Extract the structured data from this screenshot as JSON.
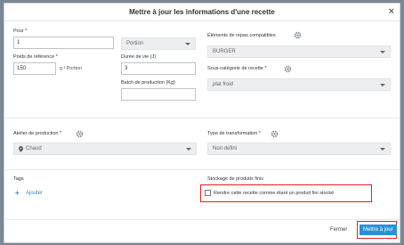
{
  "modal": {
    "title": "Mettre à jour les informations d'une recette",
    "close_symbol": "×"
  },
  "form": {
    "pour_label": "Pour *",
    "pour_value": "1",
    "portion_select": "Portion",
    "poids_label": "Poids de référence *",
    "poids_value": "150",
    "poids_unit": "g / Portion",
    "duree_label": "Durée de vie (J)",
    "duree_value": "3",
    "batch_label": "Batch de production (Kg)",
    "batch_value": "",
    "elements_label": "Éléments de repas compatibles",
    "elements_value": "BURGER",
    "souscat_label": "Sous-catégorie de recette *",
    "souscat_value": "plat froid",
    "atelier_label": "Atelier de production *",
    "atelier_value": "Chaud",
    "type_label": "Type de transformation *",
    "type_value": "Non défini",
    "tags_label": "Tags",
    "ajouter_label": "Ajouter",
    "stockage_label": "Stockage de produits finis",
    "stockage_checkbox_label": "Rendre cette recette comme étant un produit fini stocké",
    "stockage_checked": false
  },
  "footer": {
    "fermer_label": "Fermer",
    "mettre_a_jour_label": "Mettre à jour"
  },
  "colors": {
    "primary": "#2c8fd6",
    "highlight": "#e0202a",
    "backdrop": "#7c8794"
  },
  "icons": [
    "close-icon",
    "gear-icon",
    "chevron-down-icon",
    "location-pin-icon",
    "plus-icon",
    "checkbox-icon"
  ]
}
